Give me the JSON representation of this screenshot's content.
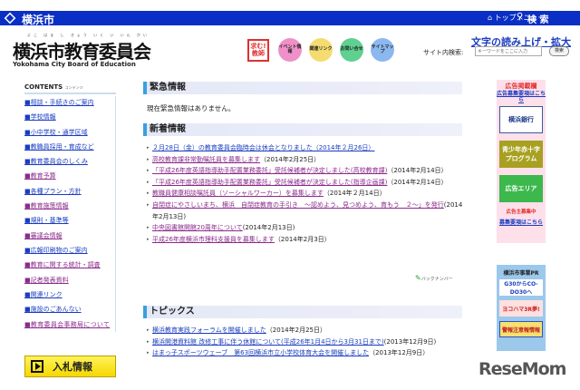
{
  "topbar": {
    "city": "横浜市",
    "top_menu": "トップメニュー",
    "search": "検 索"
  },
  "header": {
    "title": "横浜市教育委員会",
    "ruby": "よこ はま し きょう いく い いん かい",
    "subtitle": "Yokohama City Board of Education",
    "read_aloud": "文字の読み上げ・拡大",
    "search_label": "サイト内検索:",
    "search_placeholder": "キーワードをここに入力",
    "search_button": "検索",
    "icons": [
      {
        "label": "求む!教師"
      },
      {
        "label": "イベント情報",
        "color": "#f090c8"
      },
      {
        "label": "関連リンク",
        "color": "#f5dc70"
      },
      {
        "label": "お問い合せ",
        "color": "#60d090"
      },
      {
        "label": "サイトマップ",
        "color": "#8cb8f0"
      }
    ]
  },
  "sidebar": {
    "heading": "CONTENTS",
    "heading_sub": "コンテンツ",
    "items": [
      {
        "label": "■相談・手続きのご案内",
        "visited": false
      },
      {
        "label": "■学校情報",
        "visited": false
      },
      {
        "label": "■小中学校・通学区域",
        "visited": false
      },
      {
        "label": "■教職員採用・育成など",
        "visited": false
      },
      {
        "label": "■教育委員会のしくみ",
        "visited": false
      },
      {
        "label": "■教育予算",
        "visited": true
      },
      {
        "label": "■各種プラン・方針",
        "visited": false
      },
      {
        "label": "■教育施策情報",
        "visited": true
      },
      {
        "label": "■規則・基準等",
        "visited": false
      },
      {
        "label": "■審議会情報",
        "visited": true
      },
      {
        "label": "■広報印刷物のご案内",
        "visited": false
      },
      {
        "label": "■教育に関する統計・調査",
        "visited": true
      },
      {
        "label": "■記者発表資料",
        "visited": true
      },
      {
        "label": "■関連リンク",
        "visited": false
      },
      {
        "label": "■施設のごあんない",
        "visited": false
      },
      {
        "label": "■教育委員会事務局について",
        "visited": true
      }
    ],
    "bid_banner": "入札情報"
  },
  "emergency": {
    "heading": "緊急情報",
    "text": "現在緊急情報はありません。"
  },
  "news": {
    "heading": "新着情報",
    "items": [
      {
        "title": "２月28日（金）の教育委員会臨時会は休会となりました（2014年２月26日）",
        "date": "",
        "visited": false
      },
      {
        "title": "高校教育課非常勤嘱託員を募集します",
        "date": "（2014年2月25日）",
        "visited": true
      },
      {
        "title": "「平成26年度英語指導助手配置業務委託」受託候補者が決定しました(高校教育課)",
        "date": "（2014年2月14日）",
        "visited": true
      },
      {
        "title": "「平成26年度英語指導助手配置業務委託」受託候補者が決定しました(指導企画課)",
        "date": "（2014年2月14日）",
        "visited": true
      },
      {
        "title": "教職員健康相談嘱託員（ソーシャルワーカー）を募集します",
        "date": "（2014年２月14日）",
        "visited": true
      },
      {
        "title": "自閉症にやさしいまち、横浜　自閉症教育の手引き　～認めよう、見つめよう、育もう　２～」を発行",
        "date": "(2014年2月13日)",
        "visited": true
      },
      {
        "title": "中央図書館開館20周年について",
        "date": "(2014年2月13日)",
        "visited": true
      },
      {
        "title": "平成26年度横浜市理科支援員を募集します",
        "date": "（2014年2月3日）",
        "visited": true
      }
    ],
    "back_number": "バックナンバー"
  },
  "topics": {
    "heading": "トピックス",
    "items": [
      {
        "title": "横浜教育実践フォーラムを開催しました",
        "date": "（2014年2月25日）"
      },
      {
        "title": "横浜開港資料館 改修工事に伴う休館について(平成26年1月4日から3月31日まで)",
        "date": "(2013年12月9日)"
      },
      {
        "title": "はまっ子スポーツウェーブ　第63回横浜市立小学校体育大会を開催しました",
        "date": "（2013年12月9日）"
      }
    ]
  },
  "ads": {
    "heading": "広告掲載欄",
    "link": "広告募集要項はこちら",
    "banners": [
      "横浜銀行",
      "青少年赤十字プログラム",
      "広告エリア"
    ],
    "recruit": "広告主募集中",
    "recruit_link": "募集要項はこちら"
  },
  "pr": {
    "heading": "横浜市事業PR",
    "banners": [
      "G30からCO-DO30へ",
      "ヨコハマ3R夢!",
      "警報注意報情報"
    ]
  },
  "watermark": "ReseMom",
  "colors": {
    "link": "#1a3cc0",
    "visited": "#8a2a8a",
    "bar": "#0a2fc4"
  }
}
